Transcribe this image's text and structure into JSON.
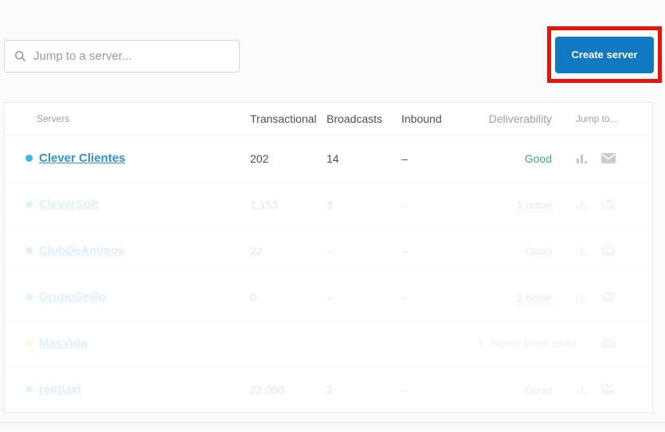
{
  "toolbar": {
    "search": {
      "placeholder": "Jump to a server...",
      "icon": "magnifier"
    },
    "create_button": {
      "label": "Create server",
      "color": "#1178c2"
    },
    "annotation_color": "#e8130c"
  },
  "table": {
    "columns": [
      "Servers",
      "Transactional",
      "Broadcasts",
      "Inbound",
      "Deliverability",
      "Jump to…"
    ],
    "status_colors": {
      "good": "#46a56d",
      "issue": "#d64540",
      "never": "#9b9b9b"
    },
    "rows": [
      {
        "name": "Clever Clientes",
        "dot_color": "#3cb8e8",
        "transactional": "202",
        "broadcasts": "14",
        "inbound": "–",
        "deliverability": "Good",
        "deliverability_status": "good",
        "faded": false,
        "icons": [
          "bar-chart",
          "envelope"
        ]
      },
      {
        "name": "CleverSoft",
        "dot_color": "#3cb8e8",
        "transactional": "1,153",
        "broadcasts": "3",
        "inbound": "–",
        "deliverability": "1 issue",
        "deliverability_status": "issue",
        "faded": true,
        "icons": [
          "bar-chart",
          "envelope"
        ]
      },
      {
        "name": "ClubDeAmigos",
        "dot_color": "#b97bd4",
        "transactional": "22",
        "broadcasts": "–",
        "inbound": "–",
        "deliverability": "Good",
        "deliverability_status": "good",
        "faded": true,
        "icons": [
          "bar-chart",
          "envelope"
        ]
      },
      {
        "name": "GrupoGrillo",
        "dot_color": "#54bfa8",
        "transactional": "0",
        "broadcasts": "–",
        "inbound": "–",
        "deliverability": "1 issue",
        "deliverability_status": "issue",
        "faded": true,
        "icons": [
          "bar-chart",
          "envelope"
        ]
      },
      {
        "name": "MasVida",
        "dot_color": "#f0c84f",
        "transactional": "",
        "broadcasts": "",
        "inbound": "",
        "deliverability": "Never been used",
        "deliverability_status": "never",
        "faded": true,
        "icons": [
          "envelope"
        ]
      },
      {
        "name": "rentUat",
        "dot_color": "#5bc8d8",
        "transactional": "22,050",
        "broadcasts": "2",
        "inbound": "–",
        "deliverability": "Good",
        "deliverability_status": "good",
        "faded": true,
        "icons": [
          "bar-chart",
          "envelope"
        ]
      }
    ]
  }
}
